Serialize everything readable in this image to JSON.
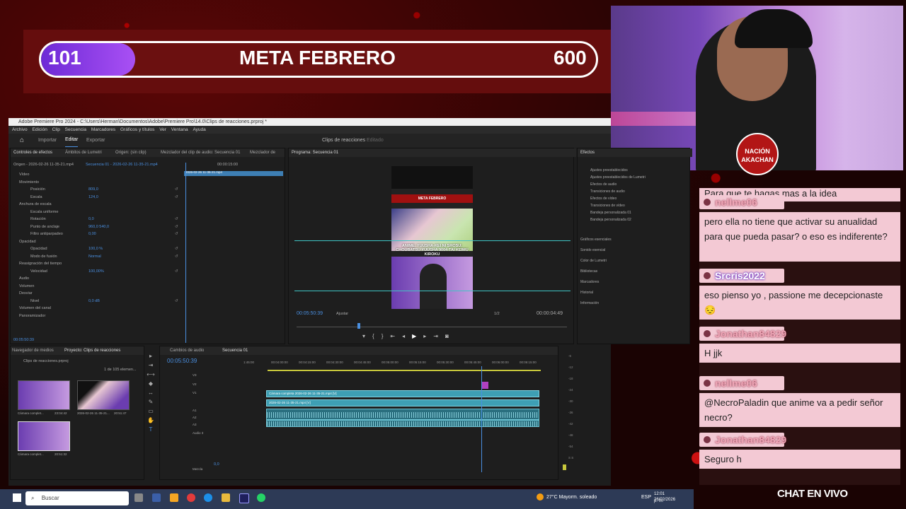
{
  "goal": {
    "current": "101",
    "title": "META FEBRERO",
    "target": "600",
    "progress_fraction": 0.17
  },
  "webcam": {
    "logo_text": "NACIÓN AKACHAN"
  },
  "premiere": {
    "title": "Adobe Premiere Pro 2024 - C:\\Users\\Herman\\Documentos\\Adobe\\Premiere Pro\\14.0\\Clips de reacciones.prproj *",
    "menu": [
      "Archivo",
      "Edición",
      "Clip",
      "Secuencia",
      "Marcadores",
      "Gráficos y títulos",
      "Ver",
      "Ventana",
      "Ayuda"
    ],
    "workspace_tabs": {
      "home": "⌂",
      "importar": "Importar",
      "editar": "Editar",
      "exportar": "Exportar"
    },
    "project_title": "Clips de reacciones",
    "project_status": "Editado",
    "effect_controls": {
      "tabs": [
        "Controles de efectos",
        "Ámbitos de Lumetri",
        "Origen: (sin clip)",
        "Mezclador del clip de audio: Secuencia 01",
        "Mezclador de"
      ],
      "source": "Origen - 2026-02-26 11-35-21.mp4",
      "sequence": "Secuencia 01 - 2026-02-26 11-35-21.mp4",
      "timecode_header": "00:00:15:00",
      "clip_label": "2026-02-26 11-35-21.mp4",
      "rows": [
        {
          "label": "Vídeo",
          "value": ""
        },
        {
          "label": "Movimiento",
          "value": ""
        },
        {
          "label": "Posición",
          "value": "809,0   "
        },
        {
          "label": "Escala",
          "value": "124,0"
        },
        {
          "label": "Anchura de escala",
          "value": ""
        },
        {
          "label": "Escala uniforme",
          "value": ""
        },
        {
          "label": "Rotación",
          "value": "0,0"
        },
        {
          "label": "Punto de anclaje",
          "value": "960,0   540,0"
        },
        {
          "label": "Filtro antiparpadeo",
          "value": "0,00"
        },
        {
          "label": "Opacidad",
          "value": ""
        },
        {
          "label": "Opacidad",
          "value": "100,0 %"
        },
        {
          "label": "Modo de fusión",
          "value": "Normal"
        },
        {
          "label": "Reasignación del tiempo",
          "value": ""
        },
        {
          "label": "Velocidad",
          "value": "100,00%"
        },
        {
          "label": "Audio",
          "value": ""
        },
        {
          "label": "Volumen",
          "value": ""
        },
        {
          "label": "Desviar",
          "value": ""
        },
        {
          "label": "Nivel",
          "value": "0,0 dB"
        },
        {
          "label": "Volumen del canal",
          "value": ""
        },
        {
          "label": "Panoramizador",
          "value": ""
        }
      ],
      "timecode_bottom": "00:05:50:39"
    },
    "program": {
      "title": "Programa: Secuencia 01",
      "timecode": "00:05:50:39",
      "fit": "Ajustar",
      "ratio": "1/2",
      "duration": "00:00:04:49",
      "video_bar_text": "META FEBRERO",
      "video_caption": "ANIME: YUUSHA-KEI NI SHOSU: CHOUBATSU YUUSHA 9004-TAI KEIMU KIROKU"
    },
    "effects": {
      "title": "Efectos",
      "folders": [
        "Ajustes preestablecidos",
        "Ajustes preestablecidos de Lumetri",
        "Efectos de audio",
        "Transiciones de audio",
        "Efectos de vídeo",
        "Transiciones de vídeo",
        "Bandeja personalizada 01",
        "Bandeja personalizada 02"
      ],
      "sections": [
        "Gráficos esenciales",
        "Sonido esencial",
        "Color de Lumetri",
        "Bibliotecas",
        "Marcadores",
        "Historial",
        "Información"
      ]
    },
    "project": {
      "tabs": [
        "Navegador de medios",
        "Proyecto: Clips de reacciones"
      ],
      "file": "Clips de reacciones.prproj",
      "count": "1 de 105 elemen...",
      "thumbs": [
        {
          "name": "Cámara complet...",
          "duration": "23:04:42"
        },
        {
          "name": "2026-02-26 11-35-21...",
          "duration": "20:51:47"
        },
        {
          "name": "Cámara complet...",
          "duration": "20:51:32"
        }
      ]
    },
    "timeline": {
      "tabs": [
        "Cambios de audio",
        "Secuencia 01"
      ],
      "timecode": "00:05:50:39",
      "ruler": [
        "1:45:00",
        "00:04:00:00",
        "00:04:15:00",
        "00:04:30:00",
        "00:04:45:00",
        "00:05:00:00",
        "00:05:15:00",
        "00:05:30:00",
        "00:05:45:00",
        "00:06:00:00",
        "00:06:15:00"
      ],
      "tracks": [
        "V3",
        "V2",
        "V1",
        "A1",
        "A2",
        "A3",
        "Audio 3",
        "Mezcla"
      ],
      "mix_value": "0,0",
      "clip_v2": "Cámara completa 2026-02-26 11-35-21.mp4 [V]",
      "clip_v1": "2026-02-26 11-35-21.mp4 [V]",
      "meter": [
        "-6",
        "-12",
        "-18",
        "-24",
        "-30",
        "-36",
        "-42",
        "-48",
        "-54",
        "S S"
      ]
    }
  },
  "taskbar": {
    "search_placeholder": "Buscar",
    "weather": "27°C  Mayorm. soleado",
    "lang": "ESP",
    "time": "12:01 p. m.",
    "date": "26/02/2026"
  },
  "chat": {
    "label": "CHAT EN VIVO",
    "messages": [
      {
        "text": "Para que te hagas mas a la idea"
      },
      {
        "user": "nellme06",
        "text": "pero ella no tiene que activar su anualidad para que pueda pasar? o eso es indiferente?"
      },
      {
        "user": "Srcris2022",
        "text": "eso pienso yo , passione me decepcionaste 😔"
      },
      {
        "user": "Jonathan84829",
        "text": "H jjk"
      },
      {
        "user": "nellme06",
        "text": "@NecroPaladin que anime va a pedir señor necro?"
      },
      {
        "user": "Jonathan84829",
        "text": "Seguro h"
      }
    ]
  },
  "colors": {
    "accent_purple": "#8a3fe6",
    "chat_bg": "#f3c9d4",
    "timeline_clip": "#3e9fb4",
    "premiere_blue": "#4a8fe0"
  }
}
